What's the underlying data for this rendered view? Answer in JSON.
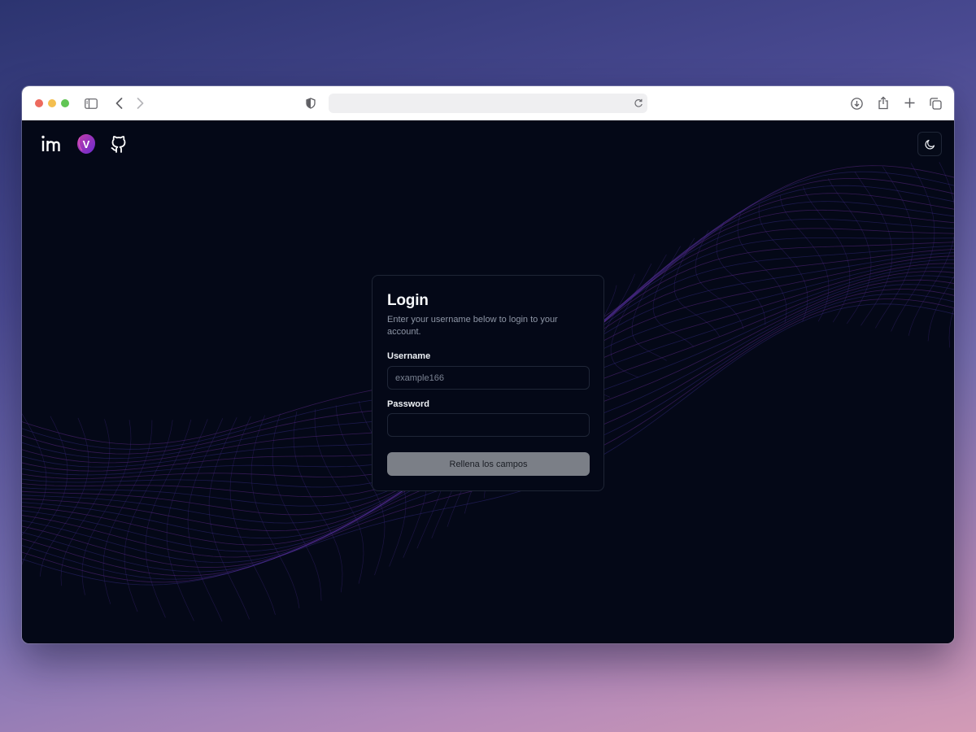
{
  "browser": {
    "traffic_lights": [
      "#ed6a5e",
      "#f4bf4f",
      "#61c554"
    ],
    "address_value": "",
    "icons": [
      "sidebar-icon",
      "back-icon",
      "forward-icon",
      "shield-icon",
      "reload-icon",
      "download-icon",
      "share-icon",
      "new-tab-icon",
      "tabs-overview-icon"
    ]
  },
  "page": {
    "social_links": [
      "linkedin-icon",
      "v-logo-icon",
      "github-icon"
    ],
    "logo_letter": "V",
    "theme_toggle": "moon-icon",
    "accent": "#8a3fd1"
  },
  "login": {
    "title": "Login",
    "description": "Enter your username below to login to your account.",
    "username_label": "Username",
    "username_placeholder": "example166",
    "password_label": "Password",
    "password_placeholder": "",
    "submit_label": "Rellena los campos"
  }
}
